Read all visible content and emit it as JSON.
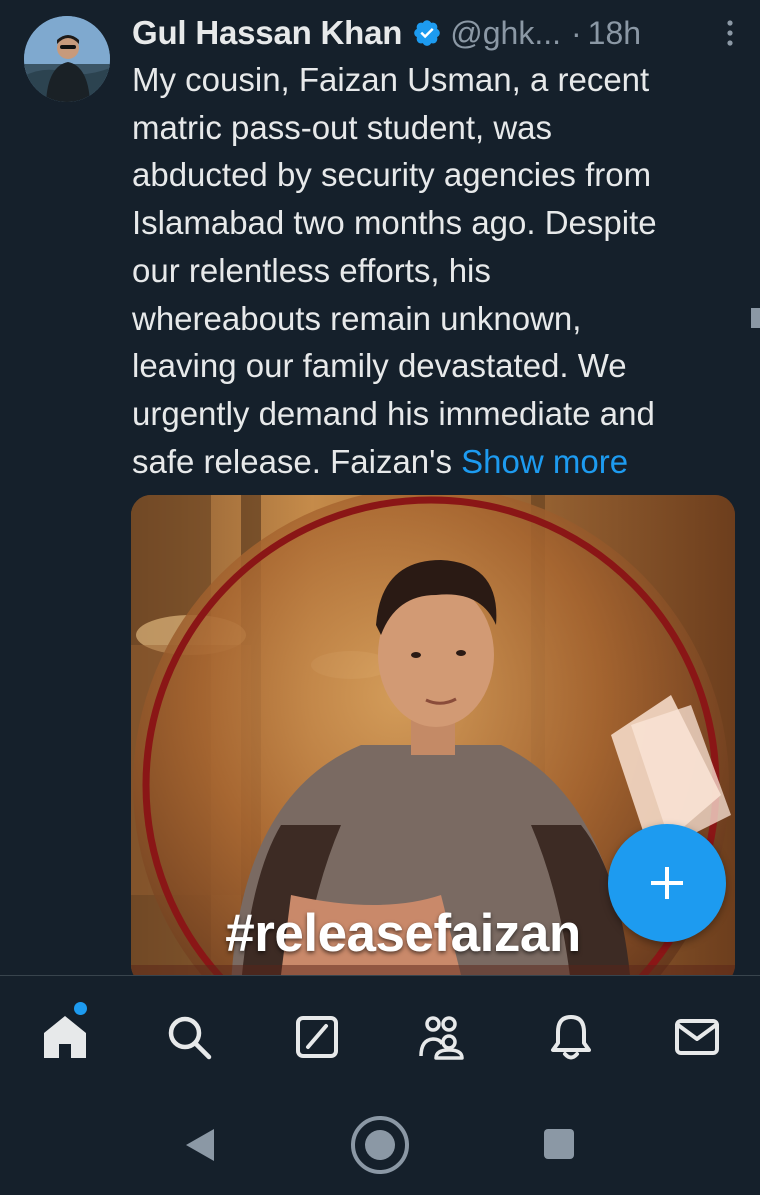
{
  "tweet": {
    "display_name": "Gul Hassan Khan",
    "handle": "@ghk...",
    "separator": "·",
    "time": "18h",
    "text": "My cousin, Faizan Usman, a recent\nmatric pass-out student, was\nabducted by security agencies from\nIslamabad two months ago. Despite\nour relentless efforts, his\nwhereabouts remain unknown,\nleaving our family devastated. We\nurgently demand his immediate and\nsafe release. Faizan's ",
    "show_more": "Show more",
    "media": {
      "hashtag": "#releasefaizan"
    }
  },
  "colors": {
    "background": "#15202b",
    "accent": "#1d9bf0",
    "text_primary": "#e7e9ea",
    "text_secondary": "#8b98a5"
  },
  "icons": {
    "verified": "verified-badge-icon",
    "more": "more-vertical-icon",
    "compose": "plus-icon",
    "nav": [
      "home-icon",
      "search-icon",
      "grok-icon",
      "communities-icon",
      "notifications-icon",
      "messages-icon"
    ],
    "system": [
      "back-icon",
      "home-circle-icon",
      "recents-icon"
    ]
  }
}
